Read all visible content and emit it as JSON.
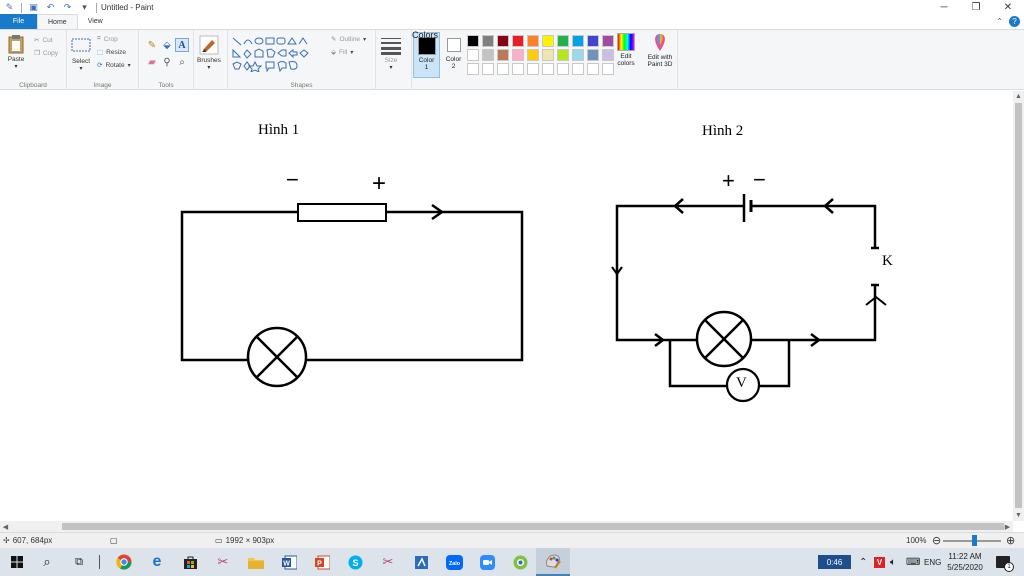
{
  "window": {
    "title": "Untitled - Paint"
  },
  "tabs": [
    {
      "label": "File"
    },
    {
      "label": "Home"
    },
    {
      "label": "View"
    }
  ],
  "ribbon": {
    "clipboard": {
      "paste": "Paste",
      "cut": "Cut",
      "copy": "Copy",
      "label": "Clipboard"
    },
    "image": {
      "select": "Select",
      "crop": "Crop",
      "resize": "Resize",
      "rotate": "Rotate",
      "label": "Image"
    },
    "tools": {
      "label": "Tools"
    },
    "brushes": {
      "label": "Brushes"
    },
    "shapes": {
      "outline": "Outline",
      "fill": "Fill",
      "label": "Shapes"
    },
    "size": {
      "label": "Size"
    },
    "color1": {
      "label": "Color",
      "num": "1"
    },
    "color2": {
      "label": "Color",
      "num": "2"
    },
    "edit_colors": {
      "line1": "Edit",
      "line2": "colors"
    },
    "paint3d": {
      "line1": "Edit with",
      "line2": "Paint 3D"
    },
    "colors": {
      "label": "Colors"
    },
    "palette": [
      "#000000",
      "#7f7f7f",
      "#880015",
      "#ed1c24",
      "#ff7f27",
      "#fff200",
      "#22b14c",
      "#00a2e8",
      "#3f48cc",
      "#a349a4",
      "#ffffff",
      "#c3c3c3",
      "#b97a57",
      "#ffaec9",
      "#ffc90e",
      "#efe4b0",
      "#b5e61d",
      "#99d9ea",
      "#7092be",
      "#c8bfe7",
      "#ffffff",
      "#ffffff",
      "#ffffff",
      "#ffffff",
      "#ffffff",
      "#ffffff",
      "#ffffff",
      "#ffffff",
      "#ffffff",
      "#ffffff"
    ]
  },
  "canvas": {
    "figure1": {
      "label": "Hình 1",
      "minus": "−",
      "plus": "+"
    },
    "figure2": {
      "label": "Hình 2",
      "plus": "+",
      "minus": "−",
      "switch": "K",
      "voltmeter": "V"
    }
  },
  "statusbar": {
    "cursor": "607, 684px",
    "canvas_size": "1992 × 903px",
    "zoom": "100%"
  },
  "taskbar": {
    "timer": "0:46",
    "language": "ENG",
    "time": "11:22 AM",
    "date": "5/25/2020",
    "notifications": "1"
  }
}
